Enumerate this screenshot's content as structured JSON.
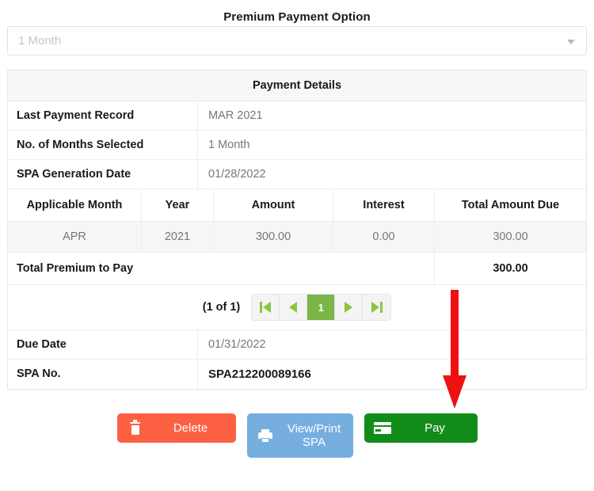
{
  "header": {
    "title": "Premium Payment Option"
  },
  "payment_option_select": {
    "name": "premium-payment-option",
    "value": "1 Month",
    "caret_icon": "chevron-down-icon"
  },
  "details": {
    "table_title": "Payment Details",
    "info_rows": [
      {
        "label": "Last Payment Record",
        "value": "MAR 2021"
      },
      {
        "label": "No. of Months Selected",
        "value": "1 Month"
      },
      {
        "label": "SPA Generation Date",
        "value": "01/28/2022"
      }
    ],
    "grid": {
      "columns": [
        "Applicable Month",
        "Year",
        "Amount",
        "Interest",
        "Total Amount Due"
      ],
      "rows": [
        {
          "month": "APR",
          "year": "2021",
          "amount": "300.00",
          "interest": "0.00",
          "total": "300.00"
        }
      ]
    },
    "total_row": {
      "label": "Total Premium to Pay",
      "value": "300.00"
    },
    "pagination": {
      "count_label": "(1 of 1)",
      "first_icon": "first-page-icon",
      "prev_icon": "previous-page-icon",
      "current_page": "1",
      "next_icon": "next-page-icon",
      "last_icon": "last-page-icon"
    },
    "footer_rows": [
      {
        "label": "Due Date",
        "value": "01/31/2022"
      },
      {
        "label": "SPA No.",
        "value": "SPA212200089166"
      }
    ]
  },
  "actions": {
    "delete": {
      "label": "Delete",
      "icon": "trash-icon",
      "color": "#fc6042"
    },
    "print": {
      "label": "View/Print\nSPA",
      "label_line1": "View/Print",
      "label_line2": "SPA",
      "icon": "printer-icon",
      "color": "#76aee0"
    },
    "pay": {
      "label": "Pay",
      "icon": "credit-card-icon",
      "color": "#118c19"
    }
  },
  "annotation": {
    "arrow": {
      "name": "pay-button-pointer-arrow",
      "color": "#ee1111",
      "direction": "down"
    }
  }
}
